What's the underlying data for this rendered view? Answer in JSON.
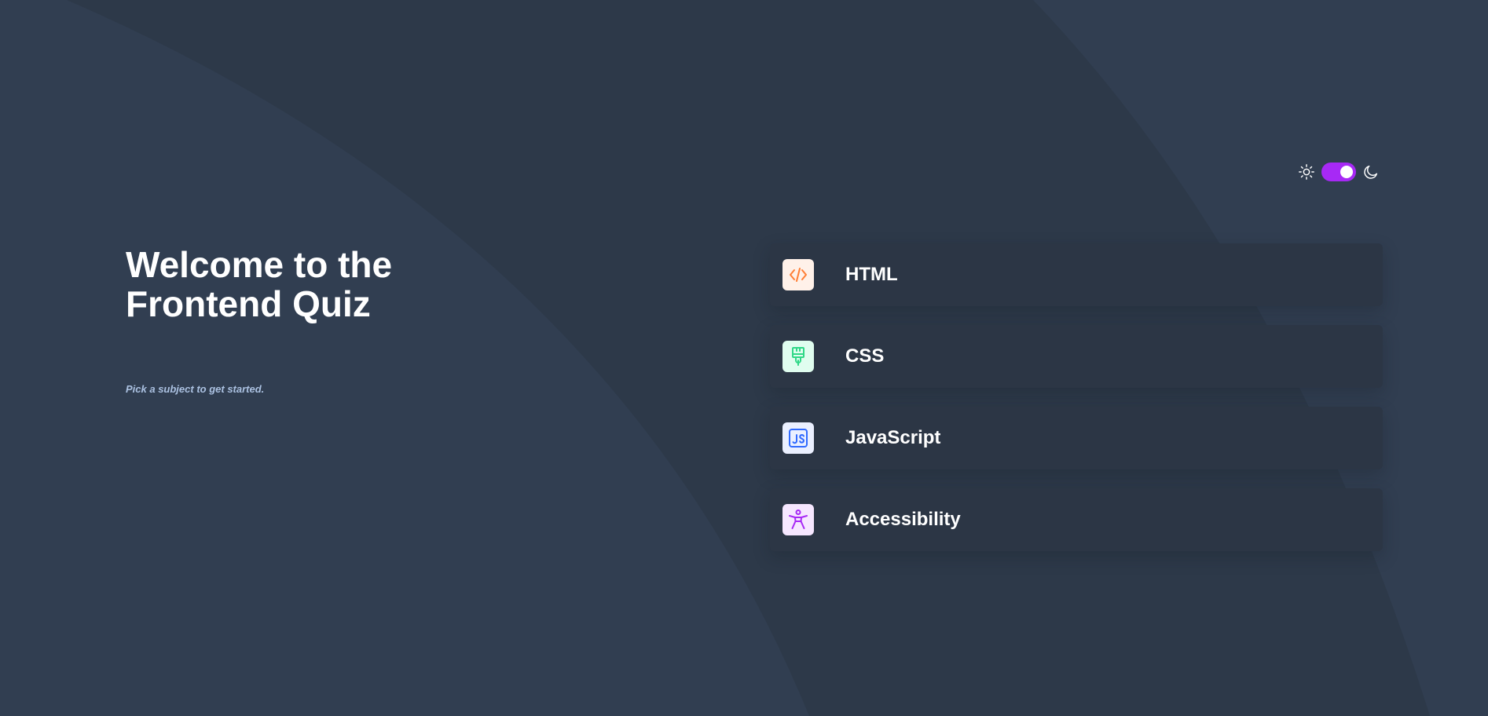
{
  "header": {
    "theme_toggle": {
      "light_icon": "sun-icon",
      "dark_icon": "moon-icon",
      "mode": "dark",
      "accent": "#a729f5"
    }
  },
  "welcome": {
    "title": "Welcome to the\nFrontend Quiz",
    "subtitle": "Pick a subject to get started."
  },
  "subjects": [
    {
      "label": "HTML",
      "icon": "html-icon",
      "icon_bg": "#fff1e9",
      "icon_color": "#ff7e35"
    },
    {
      "label": "CSS",
      "icon": "css-icon",
      "icon_bg": "#e0fdef",
      "icon_color": "#2fd887"
    },
    {
      "label": "JavaScript",
      "icon": "javascript-icon",
      "icon_bg": "#ebf0ff",
      "icon_color": "#306aff"
    },
    {
      "label": "Accessibility",
      "icon": "accessibility-icon",
      "icon_bg": "#f6e7ff",
      "icon_color": "#a729f5"
    }
  ],
  "colors": {
    "background": "#313e51",
    "card": "#2c3645",
    "text": "#ffffff",
    "muted": "#abc1e1"
  }
}
